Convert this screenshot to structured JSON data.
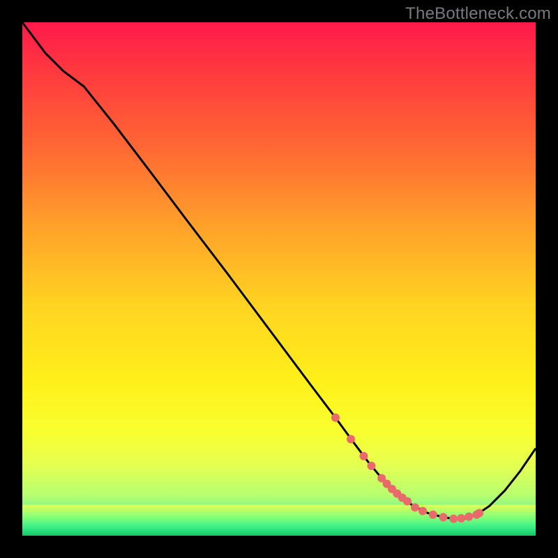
{
  "watermark": "TheBottleneck.com",
  "chart_data": {
    "type": "line",
    "title": "",
    "xlabel": "",
    "ylabel": "",
    "xlim": [
      0,
      100
    ],
    "ylim": [
      0,
      100
    ],
    "grid": false,
    "legend": false,
    "gradient_stops": [
      {
        "offset": 0.0,
        "color": "#ff1a4b"
      },
      {
        "offset": 0.1,
        "color": "#ff3a3f"
      },
      {
        "offset": 0.25,
        "color": "#ff6a33"
      },
      {
        "offset": 0.4,
        "color": "#ffa22a"
      },
      {
        "offset": 0.55,
        "color": "#ffd321"
      },
      {
        "offset": 0.7,
        "color": "#fff01a"
      },
      {
        "offset": 0.8,
        "color": "#f8ff30"
      },
      {
        "offset": 0.86,
        "color": "#e6ff50"
      },
      {
        "offset": 0.92,
        "color": "#b8ff70"
      },
      {
        "offset": 0.96,
        "color": "#70f590"
      },
      {
        "offset": 1.0,
        "color": "#10d060"
      }
    ],
    "series": [
      {
        "name": "curve",
        "color": "#000000",
        "x": [
          0.0,
          4.5,
          8.0,
          12.0,
          18.0,
          25.0,
          32.0,
          40.0,
          48.0,
          56.0,
          61.0,
          64.5,
          67.5,
          70.0,
          73.0,
          76.0,
          79.0,
          82.0,
          84.0,
          86.0,
          88.5,
          91.0,
          94.0,
          97.0,
          100.0
        ],
        "y": [
          100.0,
          94.0,
          90.5,
          87.5,
          80.0,
          70.8,
          61.5,
          51.0,
          40.3,
          29.6,
          23.0,
          18.2,
          14.2,
          11.2,
          8.2,
          5.9,
          4.4,
          3.6,
          3.3,
          3.3,
          4.1,
          5.8,
          8.8,
          12.6,
          17.0
        ]
      }
    ],
    "markers": {
      "name": "dots",
      "color": "#e96a6a",
      "radius_px": 6,
      "x": [
        61.0,
        64.0,
        66.5,
        68.0,
        70.0,
        71.0,
        72.0,
        73.0,
        74.0,
        75.0,
        76.5,
        78.0,
        80.0,
        82.0,
        84.0,
        85.5,
        87.0,
        88.5,
        89.0
      ],
      "y": [
        23.0,
        18.8,
        15.5,
        13.6,
        11.2,
        10.1,
        9.1,
        8.2,
        7.4,
        6.7,
        5.5,
        4.8,
        4.1,
        3.6,
        3.3,
        3.4,
        3.7,
        4.1,
        4.4
      ]
    },
    "green_band": {
      "y_top": 6.0,
      "y_bottom": 0.0
    }
  }
}
